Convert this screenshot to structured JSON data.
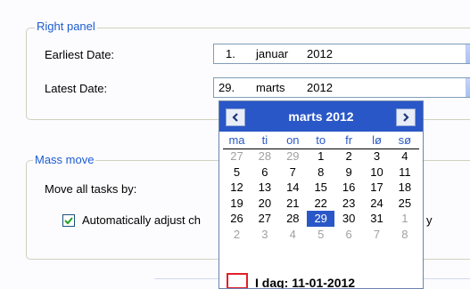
{
  "right_panel": {
    "legend": "Right panel",
    "earliest_label": "Earliest Date:",
    "earliest": {
      "day": "1.",
      "month": "januar",
      "year": "2012"
    },
    "latest_label": "Latest Date:",
    "latest": {
      "day": "29.",
      "month": "marts",
      "year": "2012"
    }
  },
  "mass_move": {
    "legend": "Mass move",
    "move_label": "Move all tasks by:",
    "auto_adjust_label": "Automatically adjust ch",
    "auto_adjust_tail": "y",
    "auto_adjust_checked": true
  },
  "calendar": {
    "title": "marts 2012",
    "prev_icon": "arrow-left-icon",
    "next_icon": "arrow-right-icon",
    "weekdays": [
      "ma",
      "ti",
      "on",
      "to",
      "fr",
      "lø",
      "sø"
    ],
    "weeks": [
      [
        {
          "d": "27",
          "o": true
        },
        {
          "d": "28",
          "o": true
        },
        {
          "d": "29",
          "o": true
        },
        {
          "d": "1"
        },
        {
          "d": "2"
        },
        {
          "d": "3"
        },
        {
          "d": "4"
        }
      ],
      [
        {
          "d": "5"
        },
        {
          "d": "6"
        },
        {
          "d": "7"
        },
        {
          "d": "8"
        },
        {
          "d": "9"
        },
        {
          "d": "10"
        },
        {
          "d": "11"
        }
      ],
      [
        {
          "d": "12"
        },
        {
          "d": "13"
        },
        {
          "d": "14"
        },
        {
          "d": "15"
        },
        {
          "d": "16"
        },
        {
          "d": "17"
        },
        {
          "d": "18"
        }
      ],
      [
        {
          "d": "19"
        },
        {
          "d": "20"
        },
        {
          "d": "21"
        },
        {
          "d": "22"
        },
        {
          "d": "23"
        },
        {
          "d": "24"
        },
        {
          "d": "25"
        }
      ],
      [
        {
          "d": "26"
        },
        {
          "d": "27"
        },
        {
          "d": "28"
        },
        {
          "d": "29",
          "s": true
        },
        {
          "d": "30"
        },
        {
          "d": "31"
        },
        {
          "d": "1",
          "o": true
        }
      ],
      [
        {
          "d": "2",
          "o": true
        },
        {
          "d": "3",
          "o": true
        },
        {
          "d": "4",
          "o": true
        },
        {
          "d": "5",
          "o": true
        },
        {
          "d": "6",
          "o": true
        },
        {
          "d": "7",
          "o": true
        },
        {
          "d": "8",
          "o": true
        }
      ]
    ],
    "today_label": "I dag: 11-01-2012"
  },
  "colors": {
    "accent": "#2a57c7",
    "legend_text": "#1d5bd1",
    "today_marker": "#e0202a"
  }
}
